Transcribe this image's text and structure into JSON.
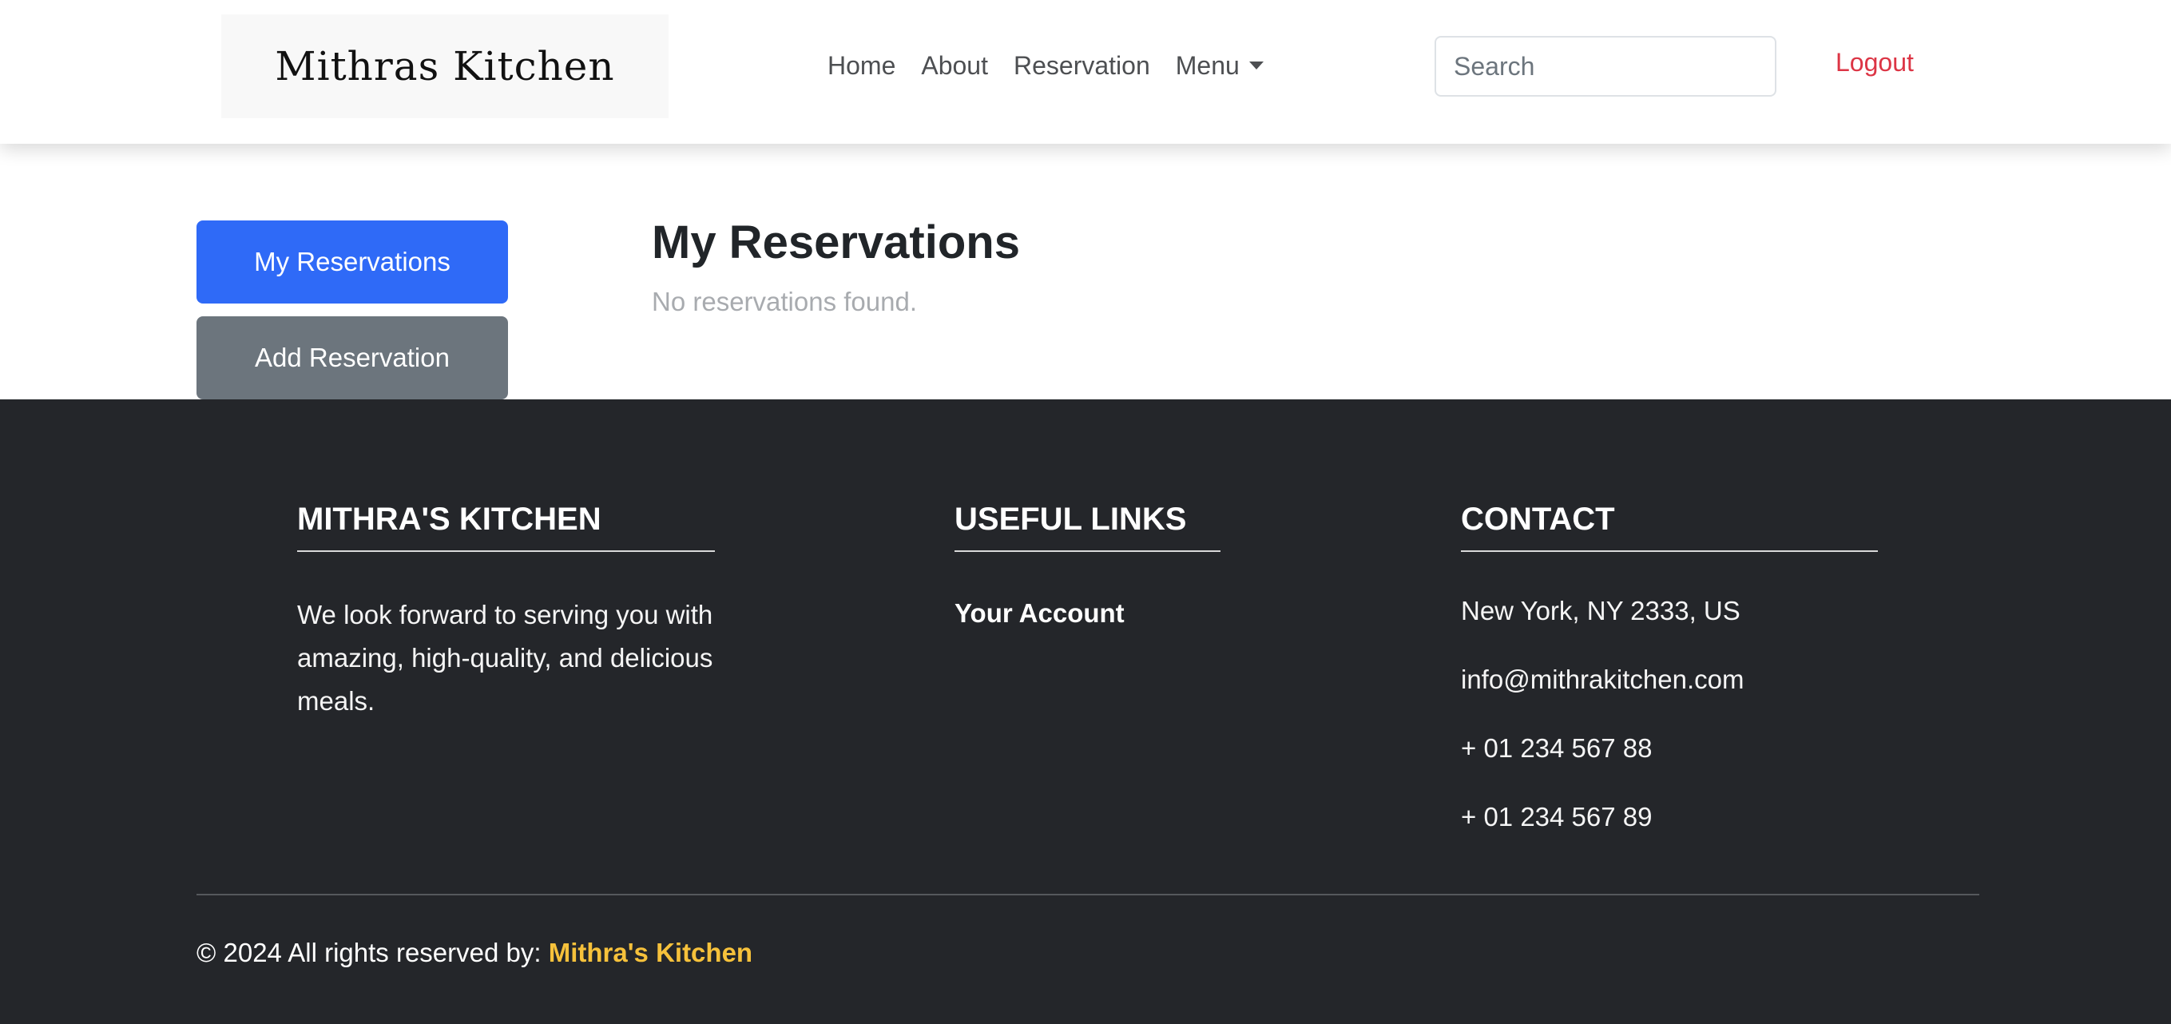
{
  "header": {
    "logo_text": "Mithras Kitchen",
    "nav": [
      {
        "label": "Home"
      },
      {
        "label": "About"
      },
      {
        "label": "Reservation"
      },
      {
        "label": "Menu"
      }
    ],
    "search_placeholder": "Search",
    "logout_label": "Logout"
  },
  "sidebar": {
    "my_reservations_label": "My Reservations",
    "add_reservation_label": "Add Reservation"
  },
  "main": {
    "title": "My Reservations",
    "empty_message": "No reservations found."
  },
  "footer": {
    "about": {
      "heading": "MITHRA'S KITCHEN",
      "text": "We look forward to serving you with amazing, high-quality, and delicious meals."
    },
    "links": {
      "heading": "USEFUL LINKS",
      "items": [
        {
          "label": "Your Account"
        }
      ]
    },
    "contact": {
      "heading": "CONTACT",
      "items": [
        {
          "text": "New York, NY 2333, US"
        },
        {
          "text": "info@mithrakitchen.com"
        },
        {
          "text": "+ 01 234 567 88"
        },
        {
          "text": "+ 01 234 567 89"
        }
      ]
    },
    "copyright_prefix": "© 2024 All rights reserved by:",
    "copyright_brand": "Mithra's Kitchen"
  },
  "colors": {
    "primary": "#2f6af7",
    "secondary": "#6c757d",
    "danger": "#dc3545",
    "footer_bg": "#24262a",
    "brand_accent": "#f6c13b"
  }
}
